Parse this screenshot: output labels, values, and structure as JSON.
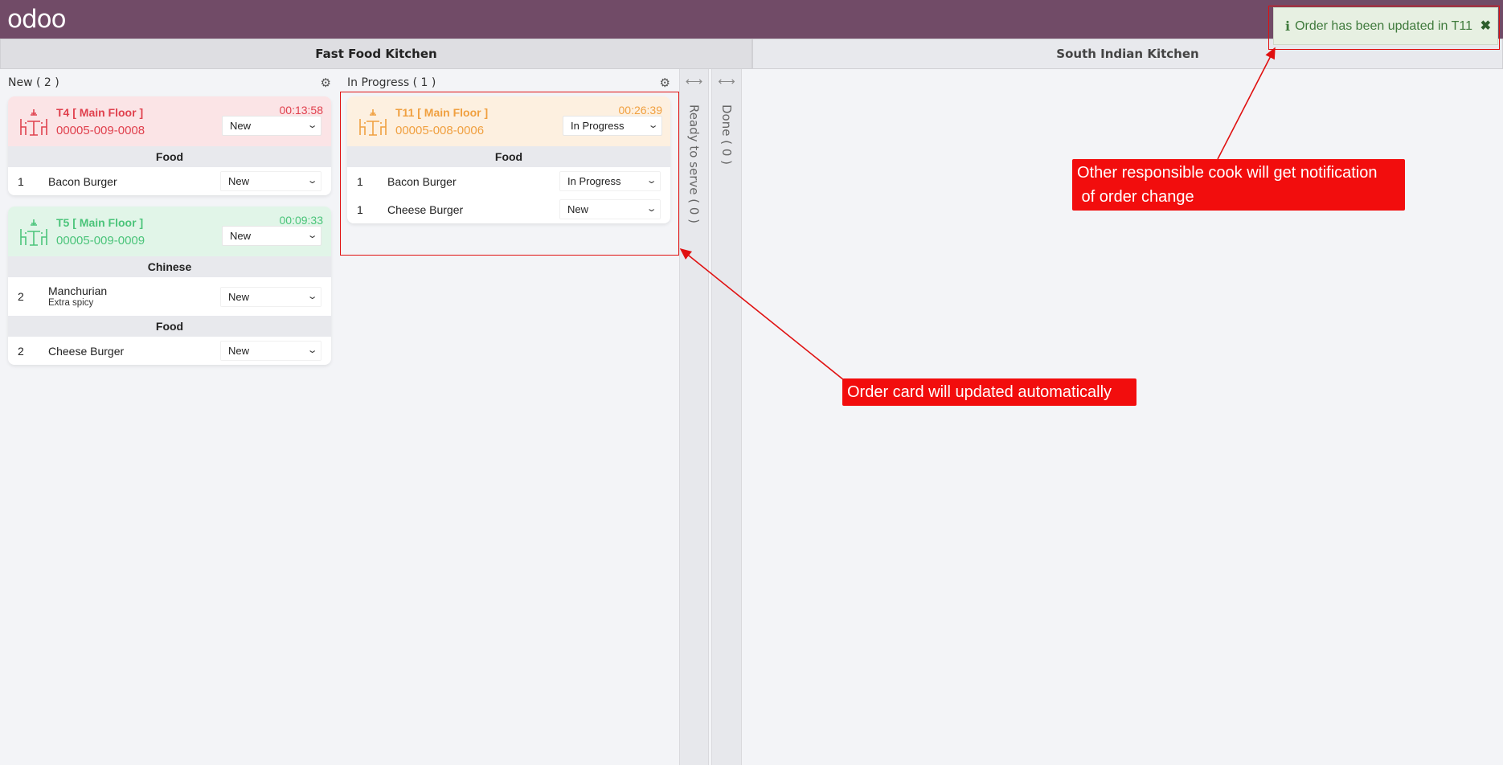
{
  "app": {
    "logo": "odoo"
  },
  "kitchens": {
    "active": "Fast Food Kitchen",
    "other": "South Indian Kitchen"
  },
  "columns": {
    "new": {
      "title": "New ( 2 )",
      "orders": [
        {
          "table": "T4 [ Main Floor ]",
          "ref": "00005-009-0008",
          "timer": "00:13:58",
          "state": "New",
          "groups": [
            {
              "category": "Food",
              "lines": [
                {
                  "qty": "1",
                  "name": "Bacon Burger",
                  "state": "New"
                }
              ]
            }
          ]
        },
        {
          "table": "T5 [ Main Floor ]",
          "ref": "00005-009-0009",
          "timer": "00:09:33",
          "state": "New",
          "groups": [
            {
              "category": "Chinese",
              "lines": [
                {
                  "qty": "2",
                  "name": "Manchurian",
                  "note": "Extra spicy",
                  "state": "New"
                }
              ]
            },
            {
              "category": "Food",
              "lines": [
                {
                  "qty": "2",
                  "name": "Cheese Burger",
                  "state": "New"
                }
              ]
            }
          ]
        }
      ]
    },
    "in_progress": {
      "title": "In Progress ( 1 )",
      "orders": [
        {
          "table": "T11 [ Main Floor ]",
          "ref": "00005-008-0006",
          "timer": "00:26:39",
          "state": "In Progress",
          "groups": [
            {
              "category": "Food",
              "lines": [
                {
                  "qty": "1",
                  "name": "Bacon Burger",
                  "state": "In Progress"
                },
                {
                  "qty": "1",
                  "name": "Cheese Burger",
                  "state": "New"
                }
              ]
            }
          ]
        }
      ]
    },
    "ready": {
      "title": "Ready to serve ( 0 )"
    },
    "done": {
      "title": "Done ( 0 )"
    }
  },
  "notification": {
    "message": "Order has been updated in T11",
    "close": "✖",
    "info": "ℹ"
  },
  "annotations": {
    "notify_line1": "Other responsible cook will get notification",
    "notify_line2": " of order change",
    "card_update": "Order card will updated automatically"
  },
  "colors": {
    "topbar": "#714b67",
    "late": "#e0414e",
    "ok": "#4bc47a",
    "progress": "#f0a040",
    "annotation": "#f20d0d"
  },
  "icons": {
    "gear": "⚙",
    "chevron": "⌄",
    "expand": "⟷",
    "table": "table-icon"
  }
}
